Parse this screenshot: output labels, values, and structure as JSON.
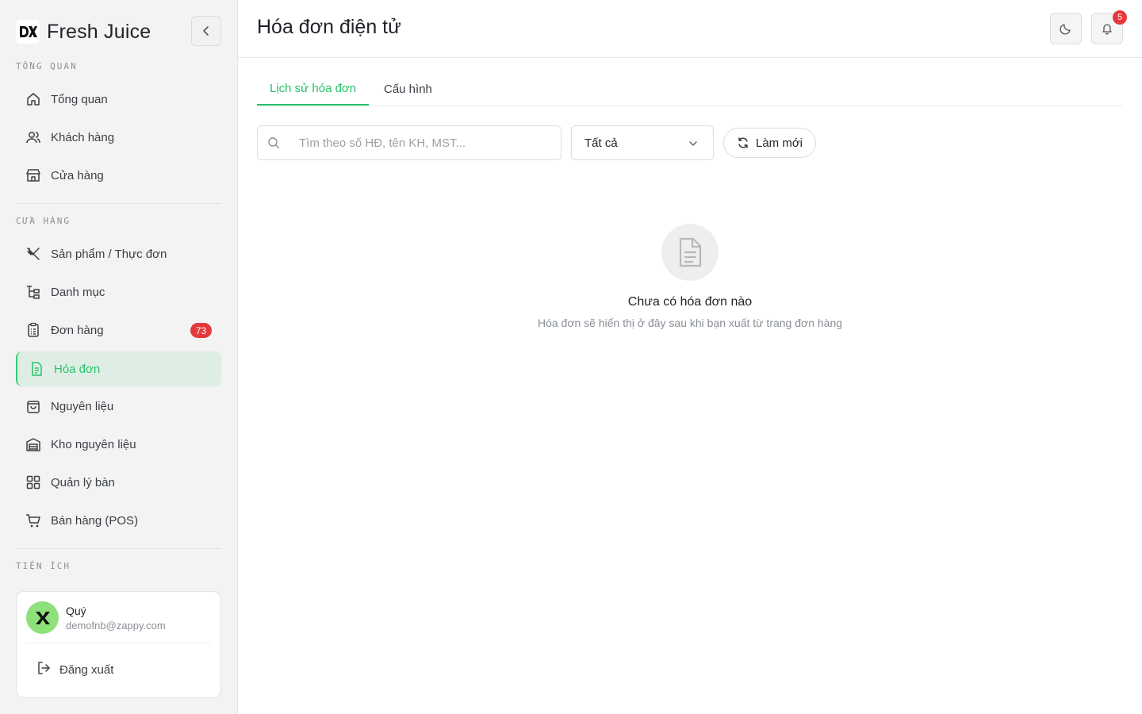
{
  "brand": {
    "name": "Fresh Juice",
    "logo_text": "DX"
  },
  "sidebar": {
    "sections": [
      {
        "label": "TỔNG QUAN"
      },
      {
        "label": "CỬA HÀNG"
      },
      {
        "label": "TIỆN ÍCH"
      }
    ],
    "items": [
      {
        "label": "Tổng quan",
        "icon": "home-icon"
      },
      {
        "label": "Khách hàng",
        "icon": "users-icon"
      },
      {
        "label": "Cửa hàng",
        "icon": "store-icon"
      },
      {
        "label": "Sản phẩm / Thực đơn",
        "icon": "utensils-icon"
      },
      {
        "label": "Danh mục",
        "icon": "category-tree-icon"
      },
      {
        "label": "Đơn hàng",
        "icon": "clipboard-icon",
        "badge": "73"
      },
      {
        "label": "Hóa đơn",
        "icon": "document-icon",
        "active": true
      },
      {
        "label": "Nguyên liệu",
        "icon": "shopping-bag-icon"
      },
      {
        "label": "Kho nguyên liệu",
        "icon": "warehouse-icon"
      },
      {
        "label": "Quản lý bàn",
        "icon": "grid-icon"
      },
      {
        "label": "Bán hàng (POS)",
        "icon": "cart-icon"
      }
    ]
  },
  "user": {
    "name": "Quý",
    "email": "demofnb@zappy.com",
    "logout_label": "Đăng xuất"
  },
  "header": {
    "title": "Hóa đơn điện tử",
    "notification_count": "5"
  },
  "tabs": [
    {
      "label": "Lịch sử hóa đơn",
      "active": true
    },
    {
      "label": "Cấu hình",
      "active": false
    }
  ],
  "toolbar": {
    "search_placeholder": "Tìm theo số HĐ, tên KH, MST...",
    "filter_value": "Tất cả",
    "refresh_label": "Làm mới"
  },
  "empty_state": {
    "title": "Chưa có hóa đơn nào",
    "description": "Hóa đơn sẽ hiển thị ở đây sau khi bạn xuất từ trang đơn hàng"
  },
  "colors": {
    "accent": "#27c26a",
    "active_bg": "#dfeee4",
    "badge": "#e5383b",
    "sidebar_bg": "#f3f3f3"
  }
}
